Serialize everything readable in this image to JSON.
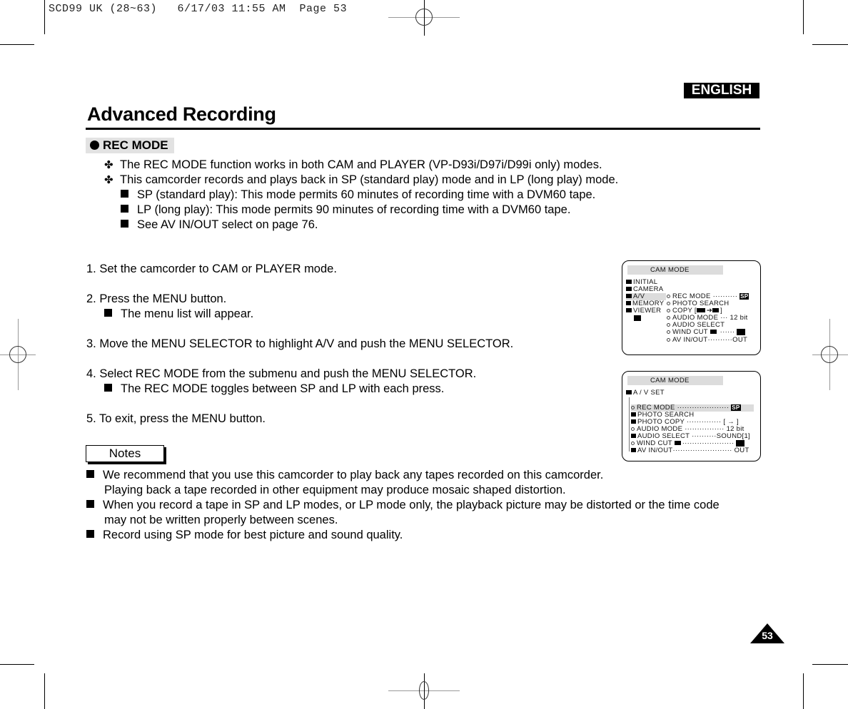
{
  "slug": "SCD99 UK (28~63)   6/17/03 11:55 AM  Page 53",
  "language_tab": "ENGLISH",
  "page_title": "Advanced Recording",
  "section_heading": "REC MODE",
  "intro": {
    "bullets": [
      "The REC MODE function works in both CAM and PLAYER (VP-D93i/D97i/D99i only) modes.",
      "This camcorder records and plays back in SP (standard play) mode and in LP (long play) mode."
    ],
    "sub_bullets": [
      "SP (standard play): This mode permits 60 minutes of recording time with a DVM60 tape.",
      "LP (long play): This mode permits 90 minutes of recording time with a DVM60 tape.",
      "See AV IN/OUT select on page 76."
    ]
  },
  "steps": [
    {
      "text": "1.  Set the camcorder to CAM or PLAYER mode.",
      "sub": ""
    },
    {
      "text": "2.  Press the MENU button.",
      "sub": "The menu list will appear."
    },
    {
      "text": "3.  Move the MENU SELECTOR to highlight A/V and push the MENU SELECTOR.",
      "sub": ""
    },
    {
      "text": "4.  Select REC MODE from the submenu and push the MENU SELECTOR.",
      "sub": "The REC MODE toggles between SP and LP with each press."
    },
    {
      "text": "5.  To exit, press the MENU button.",
      "sub": ""
    }
  ],
  "notes_label": "Notes",
  "notes": [
    {
      "line1": "We recommend that you use this camcorder to play back any tapes recorded on this camcorder.",
      "line2": "Playing back a tape recorded in other equipment may produce mosaic shaped distortion."
    },
    {
      "line1": "When you record a tape in SP and LP modes, or LP mode only, the playback picture may be distorted or the time code",
      "line2": "may not be written properly between scenes."
    },
    {
      "line1": "Record using SP mode for best picture and sound quality.",
      "line2": ""
    }
  ],
  "osd1": {
    "header": "CAM  MODE",
    "menu": [
      "INITIAL",
      "CAMERA",
      "A/V",
      "MEMORY",
      "VIEWER"
    ],
    "items": [
      {
        "label": "REC MODE",
        "dots": "··········",
        "value": "SP"
      },
      {
        "label": "PHOTO SEARCH",
        "dots": "",
        "value": ""
      },
      {
        "label": "COPY [",
        "dots": "",
        "value": "]"
      },
      {
        "label": "AUDIO MODE",
        "dots": "···",
        "value": "12 bit"
      },
      {
        "label": "AUDIO SELECT",
        "dots": "",
        "value": ""
      },
      {
        "label": "WIND CUT",
        "dots": "······",
        "value": "II"
      },
      {
        "label": "AV IN/OUT",
        "dots": "··········",
        "value": "OUT"
      }
    ]
  },
  "osd2": {
    "header": "CAM  MODE",
    "group": "A / V SET",
    "items": [
      {
        "label": "REC MODE",
        "dots": "·····················",
        "value": "SP"
      },
      {
        "label": "PHOTO SEARCH",
        "dots": "",
        "value": ""
      },
      {
        "label": "PHOTO COPY",
        "dots": "··············",
        "value": "[ → ]"
      },
      {
        "label": "AUDIO MODE",
        "dots": "················",
        "value": "12 bit"
      },
      {
        "label": "AUDIO SELECT",
        "dots": "··········",
        "value": "SOUND[1]"
      },
      {
        "label": "WIND CUT",
        "dots": "·····················",
        "value": ""
      },
      {
        "label": "AV IN/OUT",
        "dots": "························",
        "value": "OUT"
      }
    ]
  },
  "page_number": "53"
}
